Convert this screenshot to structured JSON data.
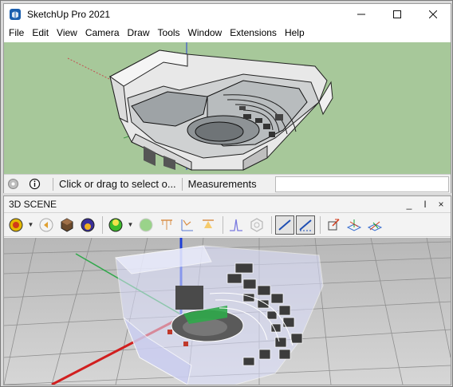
{
  "window": {
    "title": "SketchUp Pro 2021",
    "controls": [
      "—",
      "☐",
      "✕"
    ]
  },
  "menu": [
    "File",
    "Edit",
    "View",
    "Camera",
    "Draw",
    "Tools",
    "Window",
    "Extensions",
    "Help"
  ],
  "status": {
    "hint": "Click or drag to select o...",
    "measurements_label": "Measurements"
  },
  "panel": {
    "title": "3D SCENE",
    "controls": [
      "_",
      "I",
      "×"
    ]
  },
  "toolbar_icons": [
    "render-settings-icon",
    "lighting-icon",
    "material-cube-icon",
    "environment-icon",
    "sun-color-icon",
    "light-sphere-icon",
    "light-rig-icon",
    "ies-light-icon",
    "spotlight-icon",
    "histogram-icon",
    "denoise-icon",
    "edge-render-icon",
    "edge-render-alt-icon",
    "export-icon",
    "section-plane-icon",
    "clip-plane-icon"
  ],
  "colors": {
    "viewport_bg": "#a7c89a",
    "axis_red": "#d11f1f",
    "axis_green": "#1aa33a",
    "axis_blue": "#1f3fd6"
  }
}
